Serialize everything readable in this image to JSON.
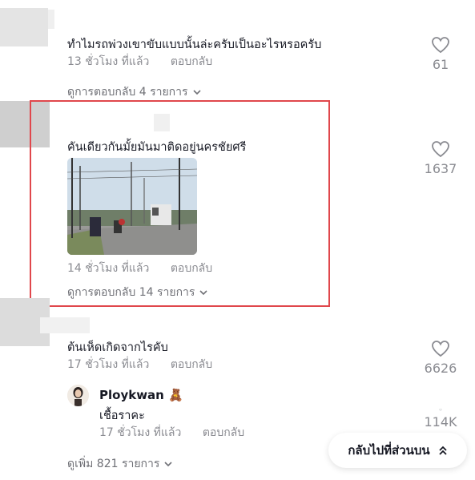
{
  "comments": [
    {
      "text": "ทำไมรถพ่วงเขาขับแบบนั้นล่ะครับเป็นอะไรหรอครับ",
      "time": "13 ชั่วโมง ที่แล้ว",
      "reply_label": "ตอบกลับ",
      "likes": "61",
      "view_replies": "ดูการตอบกลับ 4 รายการ"
    },
    {
      "text": "คันเดียวกันมั้ยมันมาติดอยู่นครชัยศรี",
      "time": "14 ชั่วโมง ที่แล้ว",
      "reply_label": "ตอบกลับ",
      "likes": "1637",
      "view_replies": "ดูการตอบกลับ 14 รายการ"
    },
    {
      "text": "ต้นเห็ดเกิดจากไรคับ",
      "time": "17 ชั่วโมง ที่แล้ว",
      "reply_label": "ตอบกลับ",
      "likes": "6626"
    }
  ],
  "reply": {
    "user": "Ploykwan",
    "emoji": "🧸",
    "text": "เชื้อราคะ",
    "time": "17 ชั่วโมง ที่แล้ว",
    "reply_label": "ตอบกลับ",
    "likes": "114K"
  },
  "view_more": "ดูเพิ่ม 821 รายการ",
  "back_to_top": "กลับไปที่ส่วนบน",
  "colors": {
    "highlight": "#e0474c",
    "muted": "#8a8b91",
    "text": "#161823"
  }
}
